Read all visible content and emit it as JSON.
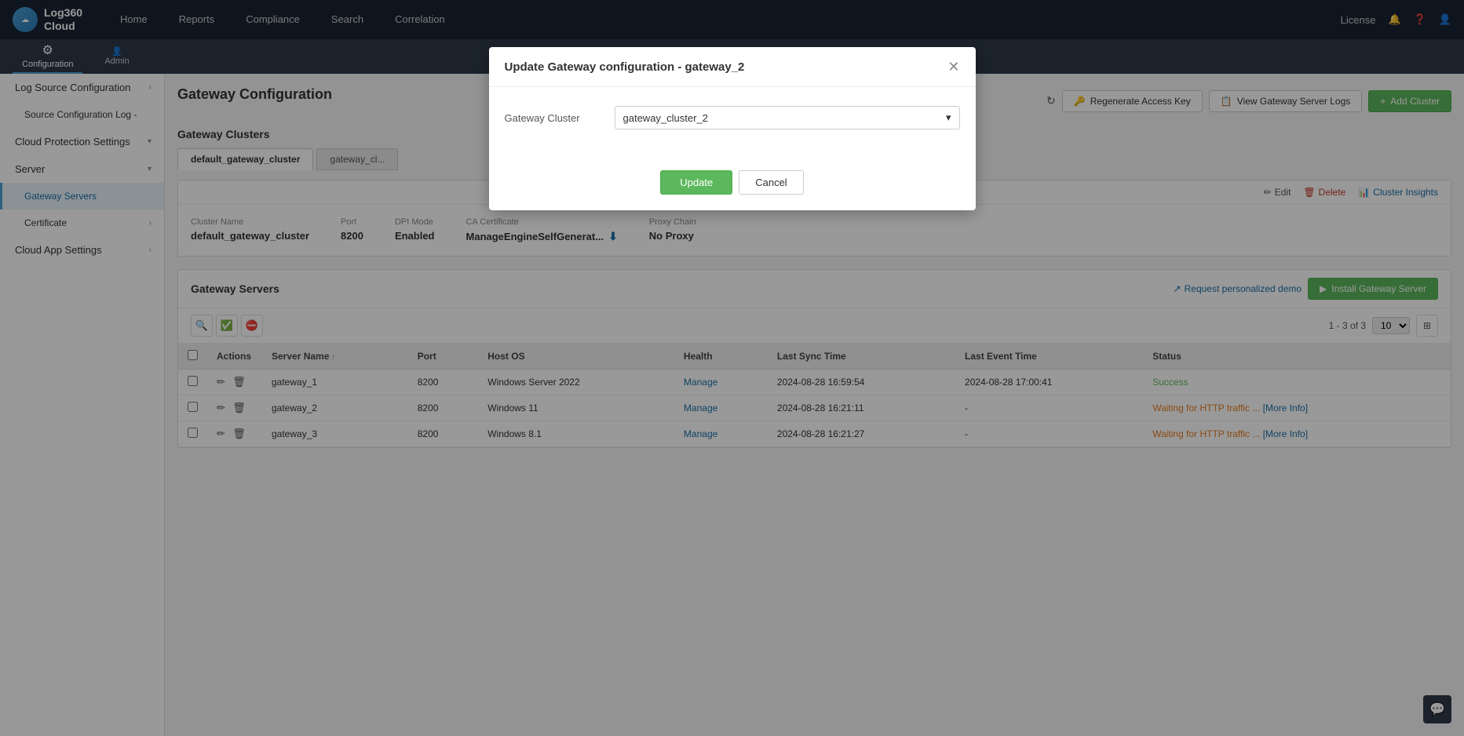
{
  "app": {
    "logo_text_line1": "Log360",
    "logo_text_line2": "Cloud"
  },
  "navbar": {
    "tabs": [
      {
        "label": "Home",
        "active": false
      },
      {
        "label": "Reports",
        "active": false
      },
      {
        "label": "Compliance",
        "active": false
      },
      {
        "label": "Search",
        "active": false
      },
      {
        "label": "Correlation",
        "active": false
      }
    ],
    "right": {
      "license": "License",
      "help": "?",
      "user": "👤"
    }
  },
  "sub_nav": {
    "config_label": "Configuration",
    "admin_label": "Admin"
  },
  "sidebar": {
    "log_source_config_label": "Log Source Configuration",
    "log_source_sub_label": "Source Configuration Log -",
    "cloud_protection_label": "Cloud Protection Settings",
    "server_label": "Server",
    "gateway_servers_label": "Gateway Servers",
    "certificate_label": "Certificate",
    "cloud_app_label": "Cloud App Settings"
  },
  "page": {
    "title": "Gateway Configuration",
    "refresh_icon": "↻",
    "top_buttons": {
      "regenerate_key": "Regenerate Access Key",
      "view_logs": "View Gateway Server Logs",
      "add_cluster": "Add Cluster"
    }
  },
  "clusters": {
    "section_title": "Gateway Clusters",
    "tabs": [
      {
        "label": "default_gateway_cluster",
        "active": true
      },
      {
        "label": "gateway_cl...",
        "active": false
      }
    ],
    "actions": {
      "edit": "Edit",
      "delete": "Delete",
      "insights": "Cluster Insights"
    },
    "info": {
      "cluster_name_label": "Cluster Name",
      "cluster_name_value": "default_gateway_cluster",
      "port_label": "Port",
      "port_value": "8200",
      "dpi_mode_label": "DPI Mode",
      "dpi_mode_value": "Enabled",
      "ca_cert_label": "CA Certificate",
      "ca_cert_value": "ManageEngineSelfGenerat...",
      "proxy_chain_label": "Proxy Chain",
      "proxy_chain_value": "No Proxy"
    }
  },
  "gateway_servers": {
    "section_title": "Gateway Servers",
    "request_demo": "Request personalized demo",
    "install_btn": "Install Gateway Server",
    "pagination": "1 - 3 of 3",
    "per_page": "10",
    "columns": [
      {
        "label": "Actions"
      },
      {
        "label": "Server Name",
        "sortable": true
      },
      {
        "label": "Port"
      },
      {
        "label": "Host OS"
      },
      {
        "label": "Health"
      },
      {
        "label": "Last Sync Time"
      },
      {
        "label": "Last Event Time"
      },
      {
        "label": "Status"
      }
    ],
    "rows": [
      {
        "server_name": "gateway_1",
        "port": "8200",
        "host_os": "Windows Server 2022",
        "health": "Manage",
        "last_sync": "2024-08-28 16:59:54",
        "last_event": "2024-08-28 17:00:41",
        "status": "Success",
        "status_type": "success"
      },
      {
        "server_name": "gateway_2",
        "port": "8200",
        "host_os": "Windows 11",
        "health": "Manage",
        "last_sync": "2024-08-28 16:21:11",
        "last_event": "-",
        "status": "Waiting for HTTP traffic ... [More Info]",
        "status_type": "waiting"
      },
      {
        "server_name": "gateway_3",
        "port": "8200",
        "host_os": "Windows 8.1",
        "health": "Manage",
        "last_sync": "2024-08-28 16:21:27",
        "last_event": "-",
        "status": "Waiting for HTTP traffic ... [More Info]",
        "status_type": "waiting"
      }
    ]
  },
  "modal": {
    "title": "Update Gateway configuration - gateway_2",
    "gateway_cluster_label": "Gateway Cluster",
    "gateway_cluster_value": "gateway_cluster_2",
    "update_btn": "Update",
    "cancel_btn": "Cancel"
  },
  "colors": {
    "primary": "#1a2332",
    "accent": "#4a9fd4",
    "success": "#5cb85c",
    "warning": "#e67e22",
    "link": "#1a6fa8"
  }
}
